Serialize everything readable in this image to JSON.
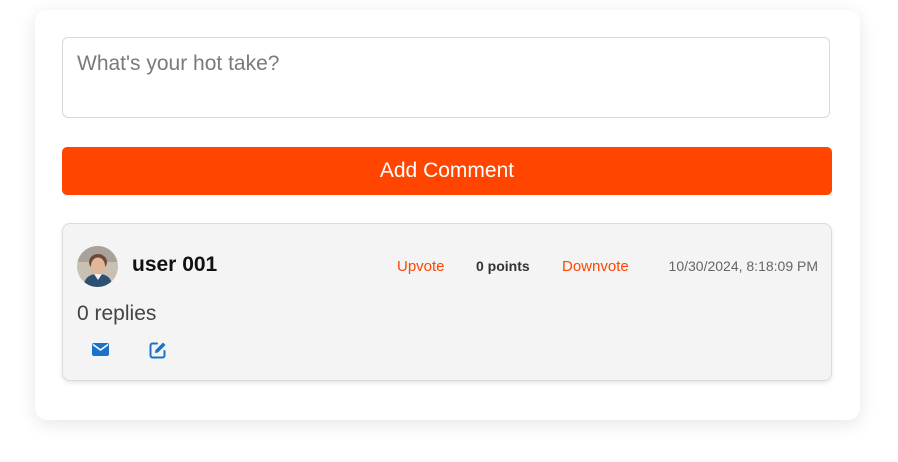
{
  "composer": {
    "placeholder": "What's your hot take?",
    "value": "",
    "submit_label": "Add Comment"
  },
  "comments": [
    {
      "username": "user 001",
      "upvote_label": "Upvote",
      "points_label": "0 points",
      "downvote_label": "Downvote",
      "timestamp": "10/30/2024, 8:18:09 PM",
      "replies_label": "0 replies",
      "actions": [
        {
          "icon": "envelope-icon"
        },
        {
          "icon": "edit-icon"
        }
      ]
    }
  ],
  "colors": {
    "accent": "#ff4500",
    "action_icon": "#1a73c9",
    "comment_background": "#f4f4f4"
  }
}
